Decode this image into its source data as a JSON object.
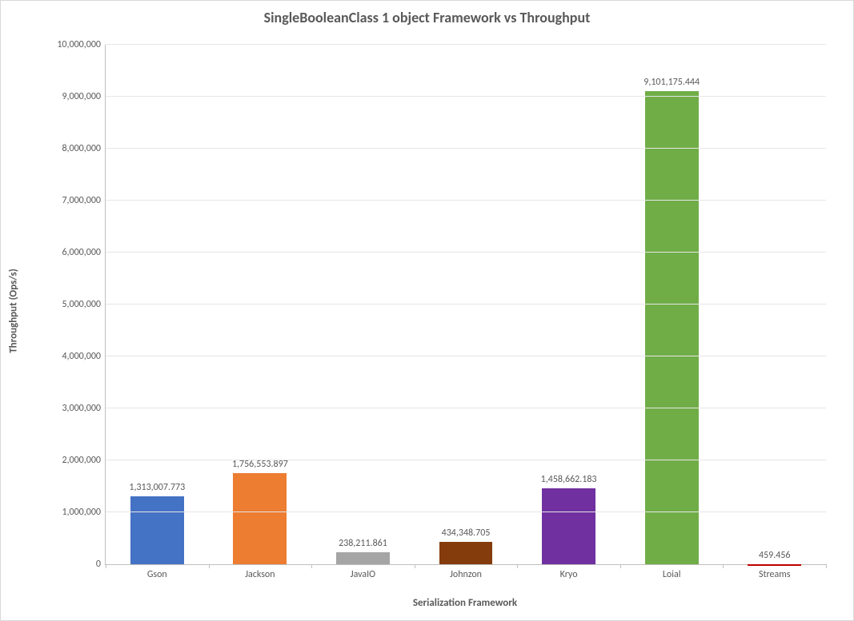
{
  "chart_data": {
    "type": "bar",
    "title": "SingleBooleanClass 1 object Framework vs Throughput",
    "xlabel": "Serialization Framework",
    "ylabel": "Throughput (Ops/s)",
    "ylim": [
      0,
      10000000
    ],
    "ystep": 1000000,
    "categories": [
      "Gson",
      "Jackson",
      "JavaIO",
      "Johnzon",
      "Kryo",
      "Loial",
      "Streams"
    ],
    "values": [
      1313007.773,
      1756553.897,
      238211.861,
      434348.705,
      1458662.183,
      9101175.444,
      459.456
    ],
    "value_labels": [
      "1,313,007.773",
      "1,756,553.897",
      "238,211.861",
      "434,348.705",
      "1,458,662.183",
      "9,101,175.444",
      "459.456"
    ],
    "colors": [
      "#4472C4",
      "#ED7D31",
      "#A5A5A5",
      "#843C0C",
      "#7030A0",
      "#70AD47",
      "#C00000"
    ],
    "y_tick_labels": [
      "0",
      "1,000,000",
      "2,000,000",
      "3,000,000",
      "4,000,000",
      "5,000,000",
      "6,000,000",
      "7,000,000",
      "8,000,000",
      "9,000,000",
      "10,000,000"
    ]
  }
}
